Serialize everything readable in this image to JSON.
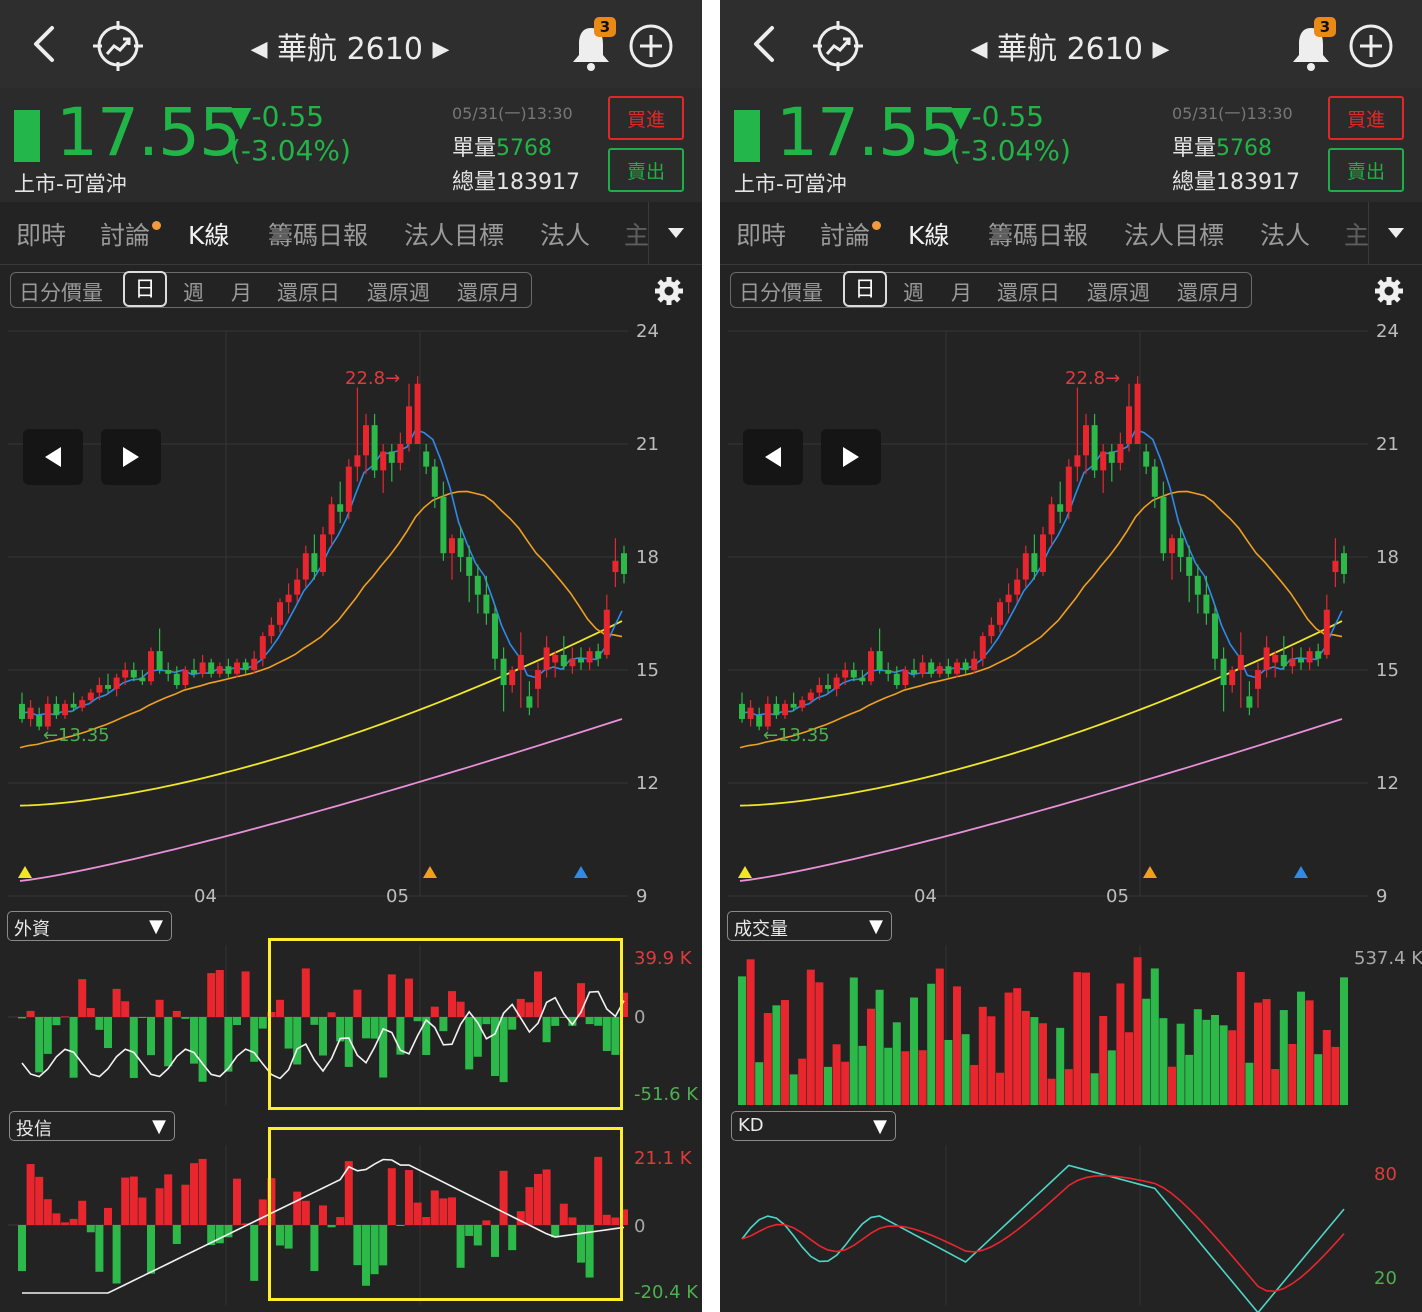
{
  "screens": [
    {
      "header": {
        "title": "華航 2610",
        "notification_count": "3"
      },
      "quote": {
        "price": "17.55",
        "change": "▼-0.55",
        "change_pct": "(-3.04%)",
        "market": "上市-可當沖",
        "time": "05/31(一)13:30",
        "unit_label": "單量",
        "unit_value": "5768",
        "total_label": "總量",
        "total_value": "183917",
        "buy_label": "買進",
        "sell_label": "賣出"
      },
      "tabs": [
        "即時",
        "討論",
        "K線",
        "籌碼日報",
        "法人目標",
        "法人",
        "主"
      ],
      "active_tab": "K線",
      "periods": [
        "日分價量",
        "日",
        "週",
        "月",
        "還原日",
        "還原週",
        "還原月"
      ],
      "selected_period": "日",
      "main_chart": {
        "y_ticks": [
          "24",
          "21",
          "18",
          "15",
          "12",
          "9"
        ],
        "x_ticks": [
          "04",
          "05"
        ],
        "high_label": "22.8→",
        "low_label": "←13.35"
      },
      "indicator1": {
        "name": "外資",
        "top": "39.9 K",
        "zero": "0",
        "bottom": "-51.6 K"
      },
      "indicator2": {
        "name": "投信",
        "top": "21.1 K",
        "zero": "0",
        "bottom": "-20.4 K"
      }
    },
    {
      "header": {
        "title": "華航 2610",
        "notification_count": "3"
      },
      "quote": {
        "price": "17.55",
        "change": "▼-0.55",
        "change_pct": "(-3.04%)",
        "market": "上市-可當沖",
        "time": "05/31(一)13:30",
        "unit_label": "單量",
        "unit_value": "5768",
        "total_label": "總量",
        "total_value": "183917",
        "buy_label": "買進",
        "sell_label": "賣出"
      },
      "tabs": [
        "即時",
        "討論",
        "K線",
        "籌碼日報",
        "法人目標",
        "法人",
        "主"
      ],
      "active_tab": "K線",
      "periods": [
        "日分價量",
        "日",
        "週",
        "月",
        "還原日",
        "還原週",
        "還原月"
      ],
      "selected_period": "日",
      "main_chart": {
        "y_ticks": [
          "24",
          "21",
          "18",
          "15",
          "12",
          "9"
        ],
        "x_ticks": [
          "04",
          "05"
        ],
        "high_label": "22.8→",
        "low_label": "←13.35"
      },
      "indicator1": {
        "name": "成交量",
        "top": "537.4 K"
      },
      "indicator2": {
        "name": "KD",
        "top": "80",
        "bottom": "20"
      }
    }
  ],
  "colors": {
    "up": "#e8262e",
    "down": "#2db94a",
    "ma5": "#2f8ae8",
    "ma20": "#f0a020",
    "ma60": "#f0e62a",
    "ma120": "#e890d8",
    "highlight": "#ffef2a"
  },
  "chart_data": [
    {
      "type": "candlestick",
      "title": "",
      "y_range": [
        9,
        24
      ],
      "y_ticks": [
        24,
        21,
        18,
        15,
        12,
        9
      ],
      "x_ticks": [
        "04",
        "05"
      ],
      "annotations": [
        "22.8",
        "13.35"
      ],
      "ohlc": [
        [
          14.1,
          14.4,
          13.6,
          13.7
        ],
        [
          13.7,
          14.2,
          13.5,
          14.0
        ],
        [
          13.8,
          14.0,
          13.4,
          13.5
        ],
        [
          13.5,
          14.3,
          13.4,
          14.1
        ],
        [
          14.1,
          14.3,
          13.7,
          13.8
        ],
        [
          13.8,
          14.2,
          13.7,
          14.1
        ],
        [
          14.1,
          14.4,
          13.9,
          14.0
        ],
        [
          14.0,
          14.3,
          13.9,
          14.2
        ],
        [
          14.2,
          14.5,
          14.1,
          14.4
        ],
        [
          14.4,
          14.8,
          14.2,
          14.6
        ],
        [
          14.6,
          14.9,
          14.4,
          14.5
        ],
        [
          14.5,
          14.9,
          14.3,
          14.8
        ],
        [
          14.8,
          15.2,
          14.6,
          15.0
        ],
        [
          15.0,
          15.2,
          14.7,
          14.8
        ],
        [
          14.8,
          15.0,
          14.6,
          14.7
        ],
        [
          14.7,
          15.6,
          14.6,
          15.5
        ],
        [
          15.5,
          16.1,
          14.9,
          15.0
        ],
        [
          15.0,
          15.2,
          14.7,
          14.9
        ],
        [
          14.9,
          15.1,
          14.5,
          14.6
        ],
        [
          14.6,
          15.1,
          14.5,
          15.0
        ],
        [
          15.0,
          15.3,
          14.8,
          14.9
        ],
        [
          14.9,
          15.4,
          14.8,
          15.2
        ],
        [
          15.2,
          15.3,
          14.8,
          14.9
        ],
        [
          14.9,
          15.2,
          14.8,
          15.1
        ],
        [
          15.1,
          15.3,
          14.8,
          14.9
        ],
        [
          14.9,
          15.3,
          14.8,
          15.2
        ],
        [
          15.2,
          15.3,
          14.9,
          15.0
        ],
        [
          15.0,
          15.5,
          14.9,
          15.3
        ],
        [
          15.3,
          16.0,
          15.1,
          15.9
        ],
        [
          15.9,
          16.4,
          15.7,
          16.2
        ],
        [
          16.2,
          16.9,
          16.0,
          16.8
        ],
        [
          16.8,
          17.3,
          16.5,
          17.0
        ],
        [
          17.0,
          17.7,
          16.8,
          17.4
        ],
        [
          17.4,
          18.3,
          17.2,
          18.1
        ],
        [
          18.1,
          18.6,
          17.4,
          17.6
        ],
        [
          17.6,
          18.8,
          17.5,
          18.6
        ],
        [
          18.6,
          19.6,
          18.3,
          19.4
        ],
        [
          19.4,
          20.0,
          18.9,
          19.2
        ],
        [
          19.2,
          20.6,
          19.0,
          20.4
        ],
        [
          20.4,
          22.5,
          20.0,
          20.7
        ],
        [
          20.7,
          21.8,
          20.2,
          21.5
        ],
        [
          21.5,
          21.8,
          20.1,
          20.3
        ],
        [
          20.3,
          21.0,
          19.7,
          20.8
        ],
        [
          20.8,
          21.0,
          20.0,
          20.5
        ],
        [
          20.5,
          21.3,
          20.3,
          21.0
        ],
        [
          21.0,
          22.6,
          20.8,
          22.0
        ],
        [
          21.0,
          22.8,
          21.0,
          22.6
        ],
        [
          20.8,
          21.0,
          20.2,
          20.4
        ],
        [
          20.4,
          20.6,
          19.3,
          19.6
        ],
        [
          19.6,
          20.0,
          17.9,
          18.1
        ],
        [
          18.1,
          18.6,
          17.4,
          18.5
        ],
        [
          18.5,
          18.8,
          17.6,
          18.0
        ],
        [
          18.0,
          18.3,
          16.8,
          17.5
        ],
        [
          17.5,
          17.8,
          16.5,
          17.0
        ],
        [
          17.0,
          17.5,
          16.2,
          16.5
        ],
        [
          16.5,
          16.7,
          15.0,
          15.3
        ],
        [
          15.3,
          15.6,
          13.9,
          14.6
        ],
        [
          14.6,
          15.1,
          14.4,
          15.0
        ],
        [
          15.0,
          16.0,
          14.0,
          15.4
        ],
        [
          14.3,
          14.7,
          13.8,
          14.0
        ],
        [
          14.5,
          15.2,
          14.0,
          15.0
        ],
        [
          15.0,
          15.9,
          14.8,
          15.6
        ],
        [
          15.2,
          15.5,
          14.8,
          15.4
        ],
        [
          15.4,
          15.9,
          15.0,
          15.1
        ],
        [
          15.1,
          15.6,
          14.9,
          15.3
        ],
        [
          15.3,
          15.6,
          15.0,
          15.2
        ],
        [
          15.2,
          15.6,
          15.0,
          15.5
        ],
        [
          15.5,
          15.7,
          15.1,
          15.3
        ],
        [
          15.4,
          17.0,
          15.3,
          16.6
        ],
        [
          17.6,
          18.5,
          17.2,
          17.9
        ],
        [
          18.1,
          18.3,
          17.3,
          17.55
        ]
      ]
    },
    {
      "type": "bar",
      "title": "外資",
      "y_range": [
        -51.6,
        39.9
      ],
      "unit": "K"
    },
    {
      "type": "bar",
      "title": "投信",
      "y_range": [
        -20.4,
        21.1
      ],
      "unit": "K"
    },
    {
      "type": "bar",
      "title": "成交量",
      "y_range": [
        0,
        537.4
      ],
      "unit": "K"
    },
    {
      "type": "line",
      "title": "KD",
      "y_ticks": [
        80,
        20
      ]
    }
  ]
}
